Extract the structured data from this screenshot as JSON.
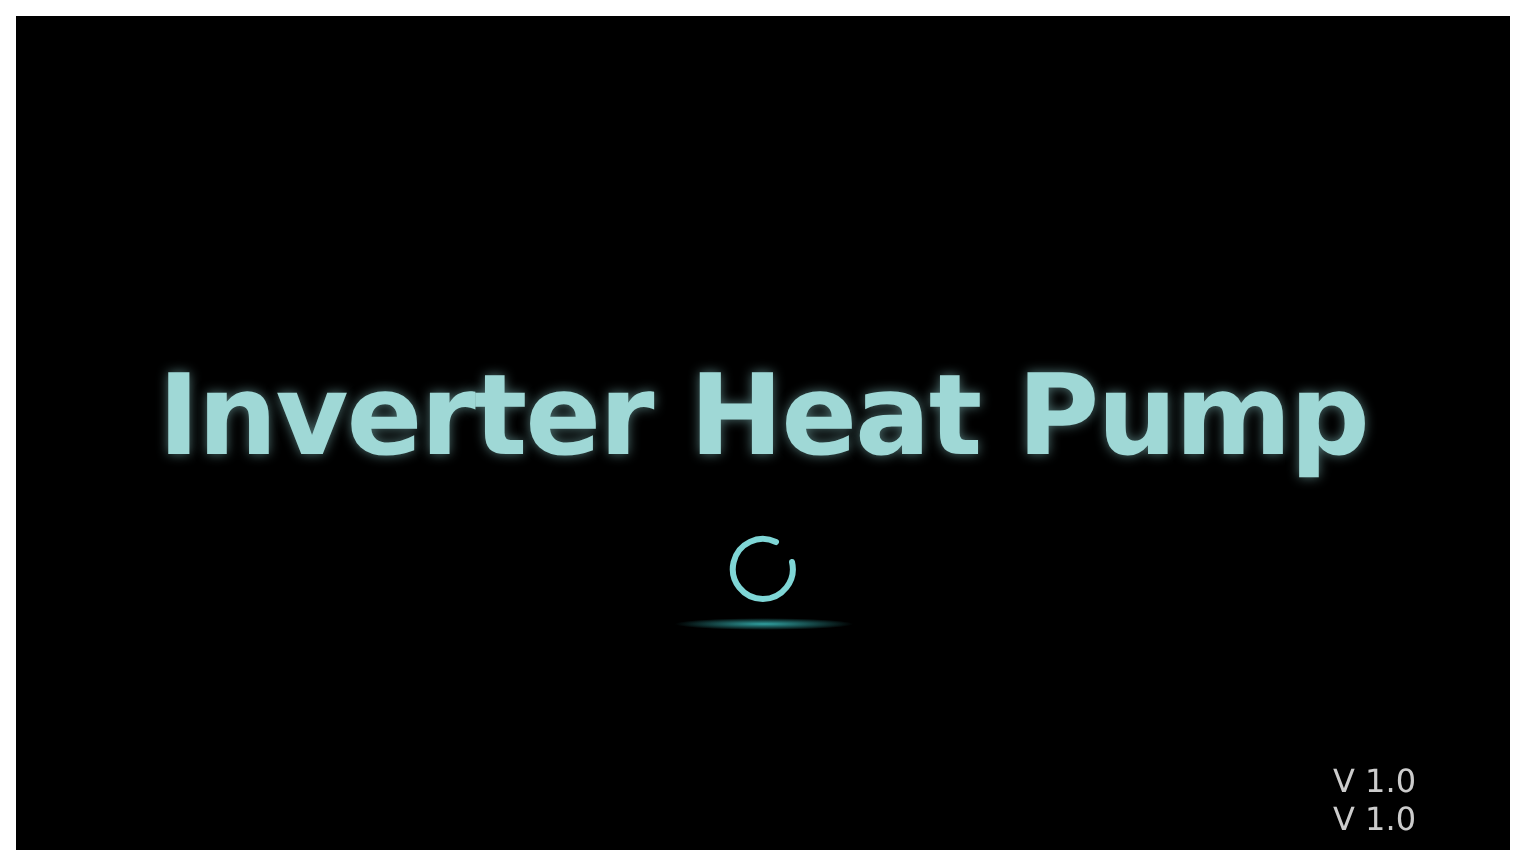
{
  "title": "Inverter Heat Pump",
  "versions": [
    "V 1.0",
    "V 1.0"
  ]
}
